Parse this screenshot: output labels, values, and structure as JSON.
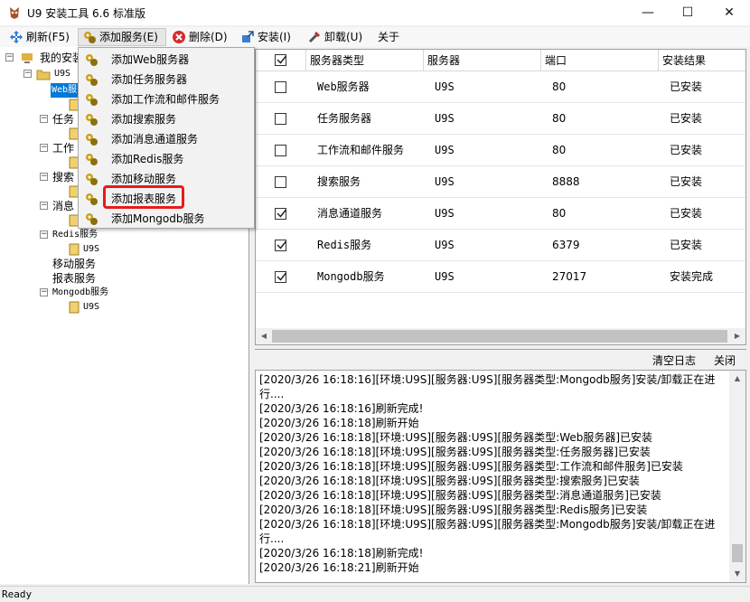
{
  "window": {
    "title": "U9 安装工具 6.6 标准版",
    "min": "—",
    "max": "☐",
    "close": "✕"
  },
  "menu": {
    "refresh": "刷新(F5)",
    "add_service": "添加服务(E)",
    "delete": "删除(D)",
    "install": "安装(I)",
    "uninstall": "卸载(U)",
    "about": "关于"
  },
  "dropdown": {
    "items": [
      "添加Web服务器",
      "添加任务服务器",
      "添加工作流和邮件服务",
      "添加搜索服务",
      "添加消息通道服务",
      "添加Redis服务",
      "添加移动服务",
      "添加报表服务",
      "添加Mongodb服务"
    ],
    "highlighted_index": 7
  },
  "tree": {
    "root": "我的安装",
    "server": "U9S",
    "web": "Web服",
    "task": "任务",
    "workflow": "工作",
    "search": "搜索",
    "message": "消息",
    "redis": "Redis服务",
    "mobile": "移动服务",
    "report": "报表服务",
    "mongodb": "Mongodb服务",
    "leaf": "U9S",
    "leaf_short": "U"
  },
  "grid": {
    "headers": [
      "",
      "服务器类型",
      "服务器",
      "端口",
      "安装结果"
    ],
    "rows": [
      {
        "checked": false,
        "type": "Web服务器",
        "server": "U9S",
        "port": "80",
        "result": "已安装"
      },
      {
        "checked": false,
        "type": "任务服务器",
        "server": "U9S",
        "port": "80",
        "result": "已安装"
      },
      {
        "checked": false,
        "type": "工作流和邮件服务",
        "server": "U9S",
        "port": "80",
        "result": "已安装"
      },
      {
        "checked": false,
        "type": "搜索服务",
        "server": "U9S",
        "port": "8888",
        "result": "已安装"
      },
      {
        "checked": true,
        "type": "消息通道服务",
        "server": "U9S",
        "port": "80",
        "result": "已安装"
      },
      {
        "checked": true,
        "type": "Redis服务",
        "server": "U9S",
        "port": "6379",
        "result": "已安装"
      },
      {
        "checked": true,
        "type": "Mongodb服务",
        "server": "U9S",
        "port": "27017",
        "result": "安装完成"
      }
    ]
  },
  "log": {
    "clear_label": "清空日志",
    "close_label": "关闭",
    "lines": [
      "[2020/3/26 16:18:16][环境:U9S][服务器:U9S][服务器类型:Mongodb服务]安装/卸载正在进",
      "行....",
      "[2020/3/26 16:18:16]刷新完成!",
      "[2020/3/26 16:18:18]刷新开始",
      "[2020/3/26 16:18:18][环境:U9S][服务器:U9S][服务器类型:Web服务器]已安装",
      "[2020/3/26 16:18:18][环境:U9S][服务器:U9S][服务器类型:任务服务器]已安装",
      "[2020/3/26 16:18:18][环境:U9S][服务器:U9S][服务器类型:工作流和邮件服务]已安装",
      "[2020/3/26 16:18:18][环境:U9S][服务器:U9S][服务器类型:搜索服务]已安装",
      "[2020/3/26 16:18:18][环境:U9S][服务器:U9S][服务器类型:消息通道服务]已安装",
      "[2020/3/26 16:18:18][环境:U9S][服务器:U9S][服务器类型:Redis服务]已安装",
      "[2020/3/26 16:18:18][环境:U9S][服务器:U9S][服务器类型:Mongodb服务]安装/卸载正在进",
      "行....",
      "[2020/3/26 16:18:18]刷新完成!",
      "[2020/3/26 16:18:21]刷新开始"
    ]
  },
  "status": {
    "text": "Ready"
  },
  "colors": {
    "selection": "#0078d7",
    "highlight_box": "#e81a1a"
  }
}
